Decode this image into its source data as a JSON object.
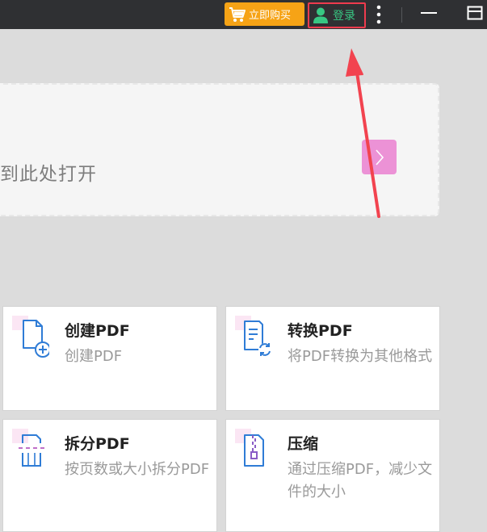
{
  "titlebar": {
    "buy_label": "立即购买",
    "login_label": "登录",
    "icons": {
      "buy": "shopping-cart-icon",
      "login": "user-icon",
      "more": "more-vertical-icon",
      "minimize": "minimize-icon",
      "maximize": "maximize-icon"
    }
  },
  "drop_zone": {
    "text": "到此处打开",
    "open_button_icon": "chevron-right-icon"
  },
  "tools": [
    {
      "title": "创建PDF",
      "desc": "创建PDF",
      "icon": "create-pdf-icon"
    },
    {
      "title": "转换PDF",
      "desc": "将PDF转换为其他格式",
      "icon": "convert-pdf-icon"
    },
    {
      "title": "拆分PDF",
      "desc": "按页数或大小拆分PDF",
      "icon": "split-pdf-icon"
    },
    {
      "title": "压缩",
      "desc": "通过压缩PDF，减少文件的大小",
      "icon": "compress-pdf-icon"
    }
  ],
  "colors": {
    "titlebar_bg": "#2f3033",
    "buy_button": "#f6a316",
    "login_text": "#38c783",
    "highlight": "#ef3b4e",
    "open_button": "#ec92d6",
    "background": "#dcdcdc"
  }
}
